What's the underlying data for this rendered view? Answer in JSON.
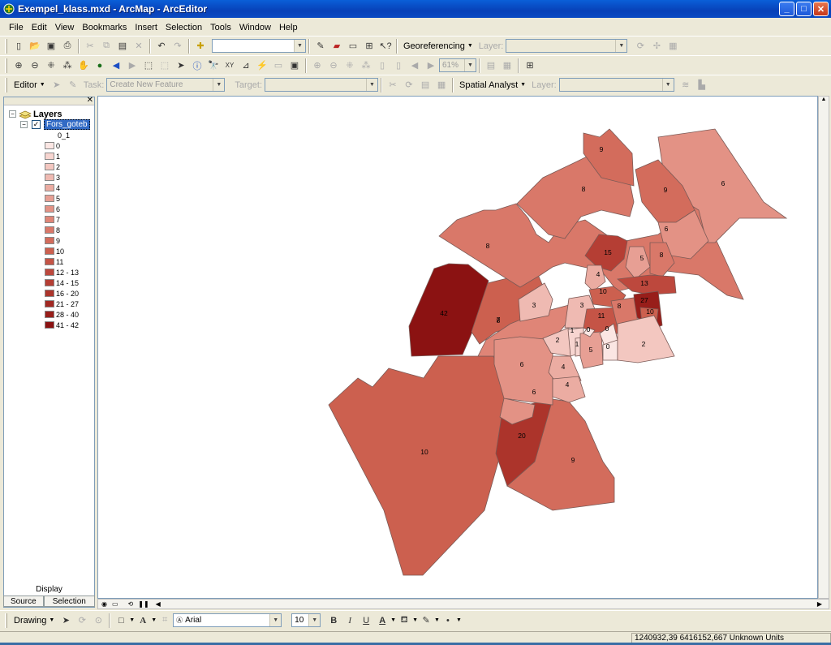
{
  "window": {
    "title": "Exempel_klass.mxd - ArcMap - ArcEditor"
  },
  "menu": [
    "File",
    "Edit",
    "View",
    "Bookmarks",
    "Insert",
    "Selection",
    "Tools",
    "Window",
    "Help"
  ],
  "toolbar1": {
    "georeferencing_label": "Georeferencing",
    "layer_label": "Layer:"
  },
  "toolbar2": {
    "zoom_value": "61%"
  },
  "toolbar3": {
    "editor_label": "Editor",
    "task_label": "Task:",
    "task_value": "Create New Feature",
    "target_label": "Target:",
    "spatial_analyst_label": "Spatial Analyst",
    "layer_label": "Layer:"
  },
  "toc": {
    "root_label": "Layers",
    "layer_name": "Fors_goteb",
    "field_label": "0_1",
    "legend": [
      {
        "label": "0",
        "color": "#fbe6e3"
      },
      {
        "label": "1",
        "color": "#f7d5d0"
      },
      {
        "label": "2",
        "color": "#f3c7c0"
      },
      {
        "label": "3",
        "color": "#efbab2"
      },
      {
        "label": "4",
        "color": "#ebaca2"
      },
      {
        "label": "5",
        "color": "#e79f94"
      },
      {
        "label": "6",
        "color": "#e39285"
      },
      {
        "label": "7",
        "color": "#df8577"
      },
      {
        "label": "8",
        "color": "#d97869"
      },
      {
        "label": "9",
        "color": "#d36c5c"
      },
      {
        "label": "10",
        "color": "#cc604f"
      },
      {
        "label": "11",
        "color": "#c55446"
      },
      {
        "label": "12 - 13",
        "color": "#bd483d"
      },
      {
        "label": "14 - 15",
        "color": "#b53e34"
      },
      {
        "label": "16 - 20",
        "color": "#ac342b"
      },
      {
        "label": "21 - 27",
        "color": "#a22822"
      },
      {
        "label": "28 - 40",
        "color": "#981e1a"
      },
      {
        "label": "41 - 42",
        "color": "#8b1212"
      }
    ],
    "display_label": "Display",
    "tabs": [
      "Source",
      "Selection"
    ]
  },
  "map": {
    "labels": [
      "42",
      "10",
      "20",
      "9",
      "8",
      "8",
      "8",
      "9",
      "6",
      "9",
      "6",
      "7",
      "3",
      "6",
      "6",
      "4",
      "4",
      "15",
      "5",
      "8",
      "13",
      "4",
      "10",
      "3",
      "27",
      "10",
      "11",
      "8",
      "2",
      "1",
      "1",
      "5",
      "0",
      "0",
      "2",
      "0"
    ]
  },
  "drawing": {
    "drawing_label": "Drawing",
    "font_name": "Arial",
    "font_size": "10"
  },
  "status": {
    "coordinates": "1240932,39  6416152,667 Unknown Units"
  }
}
